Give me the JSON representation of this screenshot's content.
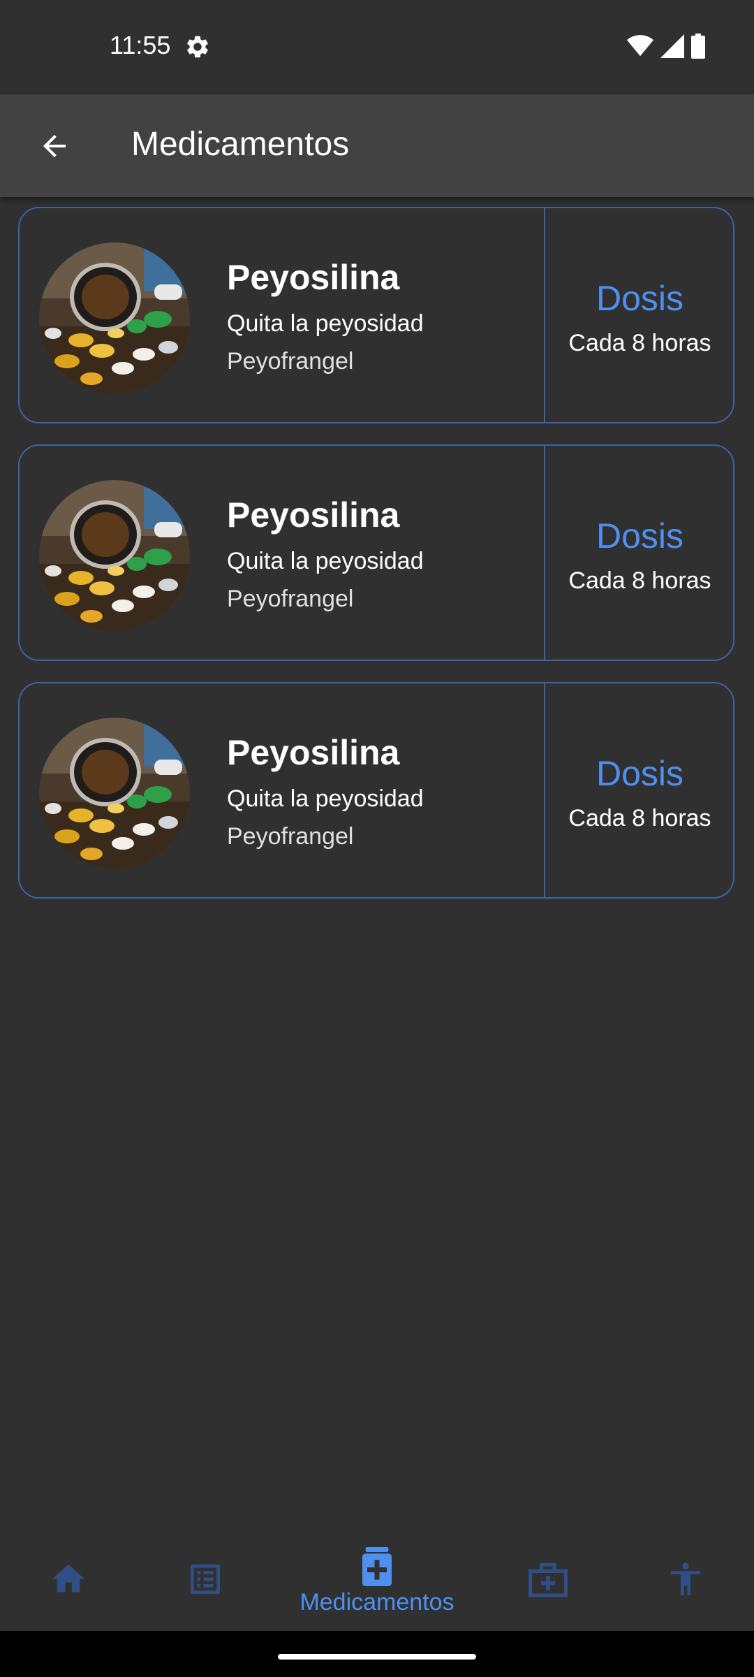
{
  "status_bar": {
    "time": "11:55"
  },
  "app_bar": {
    "title": "Medicamentos"
  },
  "medications": [
    {
      "name": "Peyosilina",
      "description": "Quita la peyosidad",
      "lab": "Peyofrangel",
      "dose_title": "Dosis",
      "dose_value": "Cada 8 horas"
    },
    {
      "name": "Peyosilina",
      "description": "Quita la peyosidad",
      "lab": "Peyofrangel",
      "dose_title": "Dosis",
      "dose_value": "Cada 8 horas"
    },
    {
      "name": "Peyosilina",
      "description": "Quita la peyosidad",
      "lab": "Peyofrangel",
      "dose_title": "Dosis",
      "dose_value": "Cada 8 horas"
    }
  ],
  "bottom_nav": {
    "items": [
      {
        "icon": "home-icon",
        "label": "",
        "active": false
      },
      {
        "icon": "list-icon",
        "label": "",
        "active": false
      },
      {
        "icon": "medicine-bottle-icon",
        "label": "Medicamentos",
        "active": true
      },
      {
        "icon": "medical-kit-icon",
        "label": "",
        "active": false
      },
      {
        "icon": "accessibility-icon",
        "label": "",
        "active": false
      }
    ]
  },
  "colors": {
    "background": "#303030",
    "app_bar": "#424242",
    "accent": "#4f8ff0",
    "card_border": "#3b63a8",
    "inactive_nav_icon": "#2f4f86"
  }
}
